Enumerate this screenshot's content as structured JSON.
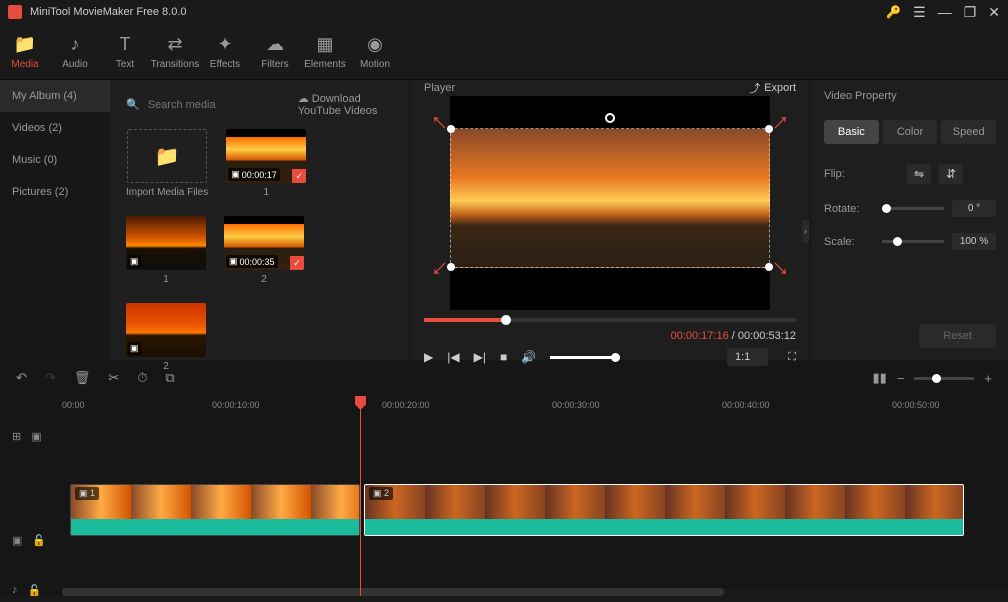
{
  "titlebar": {
    "title": "MiniTool MovieMaker Free 8.0.0"
  },
  "toolbar": [
    {
      "label": "Media",
      "icon": "folder",
      "active": true
    },
    {
      "label": "Audio",
      "icon": "note",
      "active": false
    },
    {
      "label": "Text",
      "icon": "T",
      "active": false
    },
    {
      "label": "Transitions",
      "icon": "swap",
      "active": false
    },
    {
      "label": "Effects",
      "icon": "sparkle",
      "active": false
    },
    {
      "label": "Filters",
      "icon": "cloud",
      "active": false
    },
    {
      "label": "Elements",
      "icon": "grid",
      "active": false
    },
    {
      "label": "Motion",
      "icon": "motion",
      "active": false
    }
  ],
  "mediaSidebar": [
    {
      "label": "My Album (4)",
      "active": true
    },
    {
      "label": "Videos (2)",
      "active": false
    },
    {
      "label": "Music (0)",
      "active": false
    },
    {
      "label": "Pictures (2)",
      "active": false
    }
  ],
  "mediaTop": {
    "searchPlaceholder": "Search media",
    "downloadLabel": "Download YouTube Videos"
  },
  "mediaGrid": {
    "importLabel": "Import Media Files",
    "items": [
      {
        "label": "1",
        "duration": "00:00:17",
        "checked": true,
        "type": "video",
        "style": "sunset"
      },
      {
        "label": "1",
        "type": "picture",
        "style": "sunset2"
      },
      {
        "label": "2",
        "duration": "00:00:35",
        "checked": true,
        "type": "video",
        "style": "sunset"
      },
      {
        "label": "2",
        "type": "picture",
        "style": "sunset3"
      }
    ]
  },
  "player": {
    "title": "Player",
    "exportLabel": "Export",
    "currentTime": "00:00:17:16",
    "totalTime": "00:00:53:12",
    "aspect": "1:1"
  },
  "props": {
    "title": "Video Property",
    "tabs": [
      "Basic",
      "Color",
      "Speed"
    ],
    "flipLabel": "Flip:",
    "rotateLabel": "Rotate:",
    "rotateValue": "0 °",
    "scaleLabel": "Scale:",
    "scaleValue": "100 %",
    "resetLabel": "Reset"
  },
  "timelineRuler": [
    "00:00",
    "00:00:10:00",
    "00:00:20:00",
    "00:00:30:00",
    "00:00:40:00",
    "00:00:50:00"
  ],
  "clips": [
    {
      "label": "1"
    },
    {
      "label": "2"
    }
  ]
}
